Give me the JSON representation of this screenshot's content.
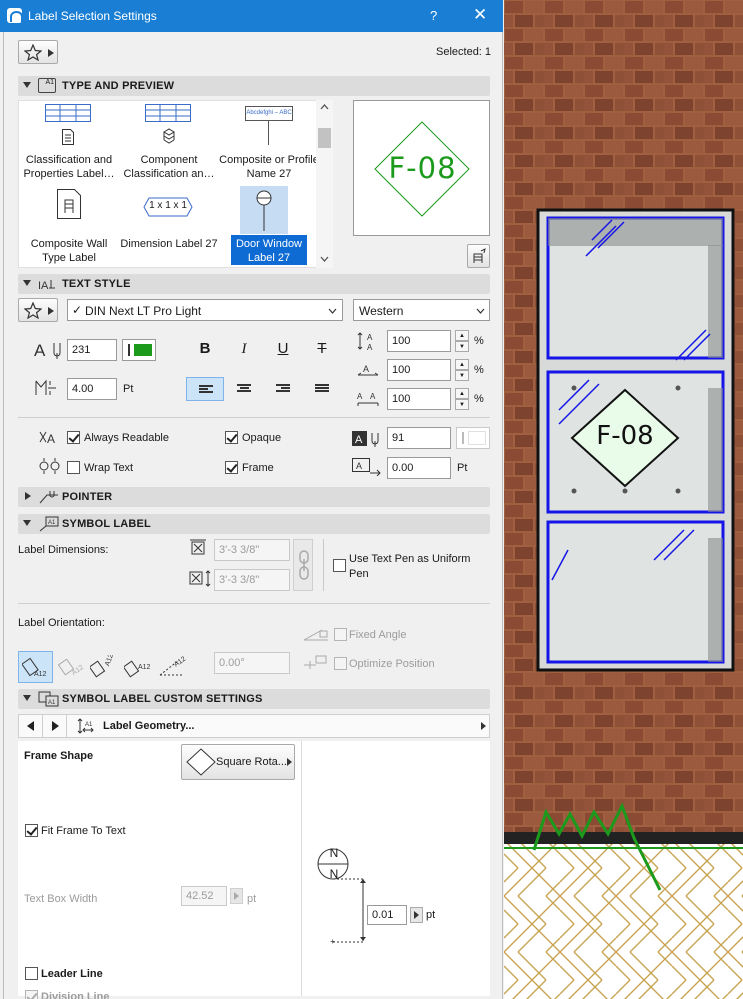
{
  "window": {
    "title": "Label Selection Settings",
    "help": "?",
    "close": "✕"
  },
  "header": {
    "selected": "Selected: 1"
  },
  "type_preview": {
    "section_title": "TYPE AND PREVIEW",
    "items": [
      {
        "label": "Classification and Properties Label…"
      },
      {
        "label": "Component Classification an…"
      },
      {
        "label": "Composite or Profile Name 27"
      },
      {
        "label": "Composite Wall Type Label"
      },
      {
        "label": "Dimension Label 27"
      },
      {
        "label": "Door Window Label 27"
      }
    ],
    "composite_sample_text": "Abcdefghi – ABC",
    "dimension_sample_text": "1 x 1 x 1",
    "preview_text": "F-08"
  },
  "text_style": {
    "section_title": "TEXT STYLE",
    "font": "DIN Next LT Pro Light",
    "font_check": "✓",
    "script": "Western",
    "pen": "231",
    "size": "4.00",
    "size_unit": "Pt",
    "width_factor": "100",
    "spacing": "100",
    "slant": "100",
    "percent": "%",
    "bold": "B",
    "italic": "I",
    "underline": "U",
    "strike": "T",
    "always_readable": "Always Readable",
    "opaque": "Opaque",
    "wrap_text": "Wrap Text",
    "frame": "Frame",
    "bg_pen": "91",
    "frame_offset": "0.00",
    "frame_offset_unit": "Pt"
  },
  "pointer": {
    "section_title": "POINTER"
  },
  "symbol_label": {
    "section_title": "SYMBOL LABEL",
    "dimensions_label": "Label Dimensions:",
    "width_value": "3'-3 3/8\"",
    "height_value": "3'-3 3/8\"",
    "use_text_pen": "Use Text Pen as Uniform Pen",
    "orientation_label": "Label Orientation:",
    "angle_value": "0.00°",
    "fixed_angle": "Fixed Angle",
    "optimize_position": "Optimize Position"
  },
  "custom_settings": {
    "section_title": "SYMBOL LABEL CUSTOM SETTINGS",
    "page_name": "Label Geometry...",
    "frame_shape_label": "Frame Shape",
    "frame_shape_value": "Square Rota...",
    "fit_frame": "Fit Frame To Text",
    "text_box_width_label": "Text Box Width",
    "text_box_width_value": "42.52",
    "text_box_width_unit": "pt",
    "offset_value": "0.01",
    "offset_unit": "pt",
    "leader_line": "Leader Line",
    "division_line": "Division Line",
    "compass_letter": "N"
  },
  "drawing": {
    "tag_text": "F-08"
  },
  "colors": {
    "accent": "#1a7fd4",
    "selected_item": "#0f6bd4",
    "green": "#1b9a1b",
    "brick": "#8a4a33",
    "frame_blue": "#1515e8"
  }
}
